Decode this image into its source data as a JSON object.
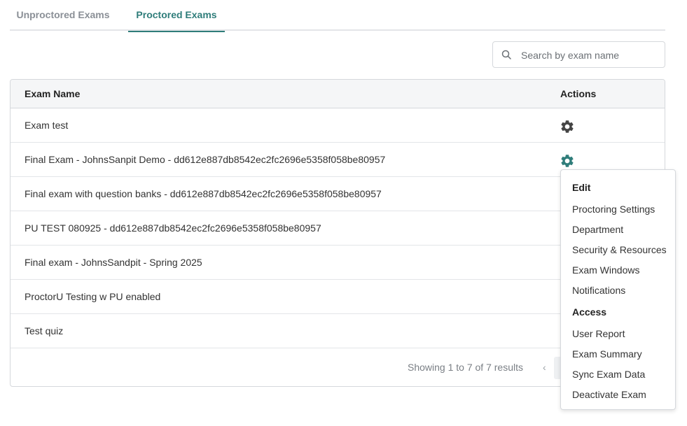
{
  "tabs": [
    {
      "label": "Unproctored Exams",
      "active": false
    },
    {
      "label": "Proctored Exams",
      "active": true
    }
  ],
  "search": {
    "placeholder": "Search by exam name",
    "value": ""
  },
  "table": {
    "headers": {
      "name": "Exam Name",
      "actions": "Actions"
    },
    "rows": [
      {
        "name": "Exam test"
      },
      {
        "name": "Final Exam - JohnsSanpit Demo - dd612e887db8542ec2fc2696e5358f058be80957"
      },
      {
        "name": "Final exam with question banks - dd612e887db8542ec2fc2696e5358f058be80957"
      },
      {
        "name": "PU TEST 080925 - dd612e887db8542ec2fc2696e5358f058be80957"
      },
      {
        "name": "Final exam - JohnsSandpit - Spring 2025"
      },
      {
        "name": "ProctorU Testing w PU enabled"
      },
      {
        "name": "Test quiz"
      }
    ],
    "footer": {
      "showing": "Showing 1 to 7 of 7 results",
      "prev": "‹"
    }
  },
  "menu": {
    "edit_header": "Edit",
    "edit_items": [
      "Proctoring Settings",
      "Department",
      "Security & Resources",
      "Exam Windows",
      "Notifications"
    ],
    "access_header": "Access",
    "access_items": [
      "User Report",
      "Exam Summary",
      "Sync Exam Data",
      "Deactivate Exam"
    ]
  },
  "colors": {
    "accent": "#2f7d7a",
    "gear_default": "#444444",
    "gear_active": "#2f7d7a"
  },
  "icons": {
    "search": "search-icon",
    "gear": "gear-icon"
  }
}
